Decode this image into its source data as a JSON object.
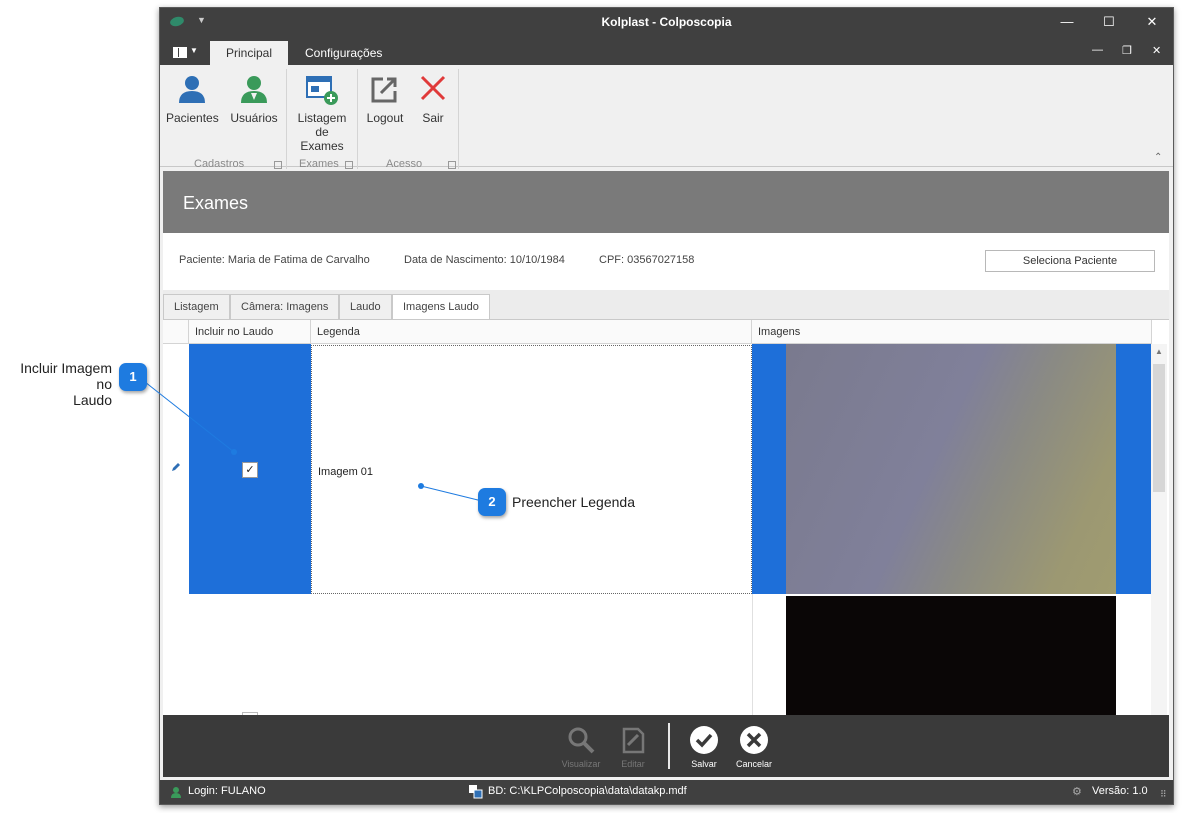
{
  "window": {
    "title": "Kolplast - Colposcopia"
  },
  "ribbon_tabs": [
    "Principal",
    "Configurações"
  ],
  "ribbon": {
    "buttons": {
      "pacientes": "Pacientes",
      "usuarios": "Usuários",
      "listagem_line1": "Listagem",
      "listagem_line2": "de Exames",
      "logout": "Logout",
      "sair": "Sair"
    },
    "groups": {
      "cadastros": "Cadastros",
      "exames": "Exames",
      "acesso": "Acesso"
    }
  },
  "page": {
    "header": "Exames"
  },
  "patient": {
    "name": "Paciente: Maria de Fatima de Carvalho",
    "dob": "Data de Nascimento: 10/10/1984",
    "cpf": "CPF: 03567027158",
    "select_button": "Seleciona Paciente"
  },
  "tabs": [
    "Listagem",
    "Câmera: Imagens",
    "Laudo",
    "Imagens Laudo"
  ],
  "grid": {
    "columns": [
      "Incluir no Laudo",
      "Legenda",
      "Imagens"
    ],
    "rows": [
      {
        "include": true,
        "legend": "Imagem 01"
      },
      {
        "include": false,
        "legend": ""
      }
    ]
  },
  "toolbar": {
    "visualizar": "Visualizar",
    "editar": "Editar",
    "salvar": "Salvar",
    "cancelar": "Cancelar"
  },
  "status": {
    "login": "Login: FULANO",
    "db": "BD: C:\\KLPColposcopia\\data\\datakp.mdf",
    "version": "Versão: 1.0"
  },
  "callouts": [
    {
      "num": "1",
      "text_line1": "Incluir Imagem no",
      "text_line2": "Laudo"
    },
    {
      "num": "2",
      "text": "Preencher Legenda"
    }
  ],
  "colors": {
    "accent": "#1e6fd9",
    "titlebar": "#404040",
    "callout": "#1e7be0"
  }
}
